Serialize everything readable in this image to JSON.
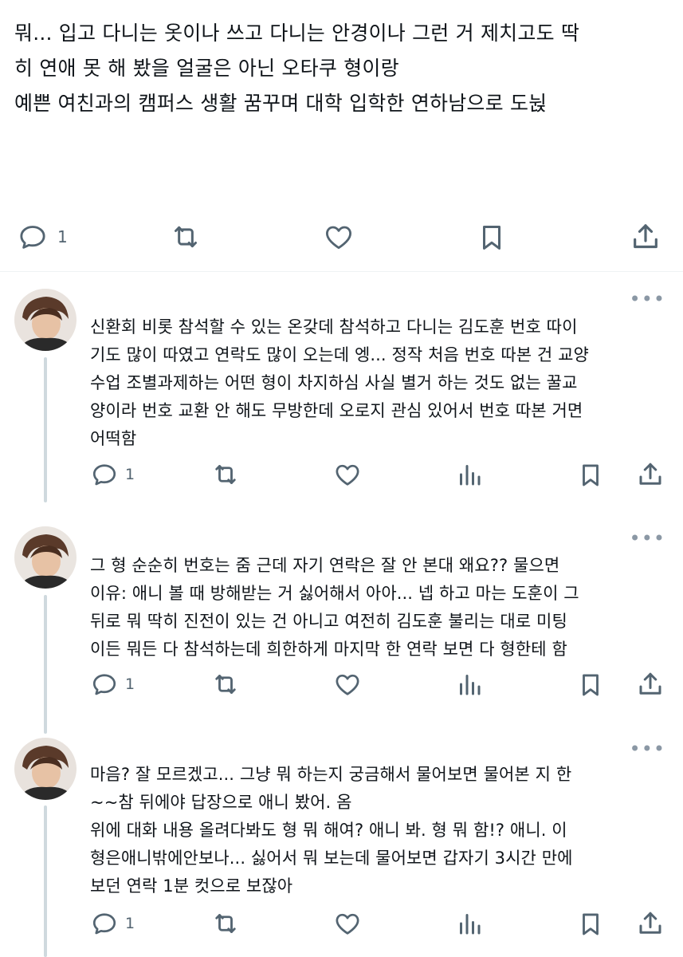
{
  "main_tweet": {
    "text": "뭐... 입고 다니는 옷이나 쓰고 다니는 안경이나 그런 거 제치고도 딱\n히 연애 못 해 봤을 얼굴은 아닌 오타쿠 형이랑\n예쁜 여친과의 캠퍼스 생활 꿈꾸며 대학 입학한 연하남으로 도뉝",
    "reply_count": "1",
    "actions": {
      "reply_icon": "reply-icon",
      "retweet_icon": "retweet-icon",
      "like_icon": "heart-icon",
      "bookmark_icon": "bookmark-icon",
      "share_icon": "share-icon"
    }
  },
  "replies": [
    {
      "text": "신환회 비롯 참석할 수 있는 온갖데 참석하고 다니는 김도훈 번호 따이\n기도 많이 따였고 연락도 많이 오는데 엥... 정작 처음 번호 따본 건 교양\n수업 조별과제하는 어떤 형이 차지하심 사실 별거 하는 것도 없는 꿀교\n양이라 번호 교환 안 해도 무방한데 오로지 관심 있어서 번호 따본 거면\n어떡함",
      "reply_count": "1",
      "more": "•••"
    },
    {
      "text": "그 형 순순히 번호는 줌 근데 자기 연락은 잘 안 본대 왜요?? 물으면\n이유: 애니 볼 때 방해받는 거 싫어해서 아아... 넵 하고 마는 도훈이 그\n뒤로 뭐 딱히 진전이 있는 건 아니고 여전히 김도훈 불리는 대로 미팅\n이든 뭐든 다 참석하는데 희한하게 마지막 한 연락 보면 다 형한테 함",
      "reply_count": "1",
      "more": "•••"
    },
    {
      "text": "마음? 잘 모르겠고... 그냥 뭐 하는지 궁금해서 물어보면 물어본 지 한\n~~참 뒤에야 답장으로 애니 봤어. 옴\n위에 대화 내용 올려다봐도 형 뭐 해여? 애니 봐. 형 뭐 함!? 애니. 이\n형은애니밖에안보나... 싫어서 뭐 보는데 물어보면 갑자기 3시간 만에\n보던 연락 1분 컷으로 보잖아",
      "reply_count": "1",
      "more": "•••"
    }
  ],
  "colors": {
    "icon": "#536471",
    "divider": "#eff3f4",
    "thread_line": "#cfd9de"
  }
}
